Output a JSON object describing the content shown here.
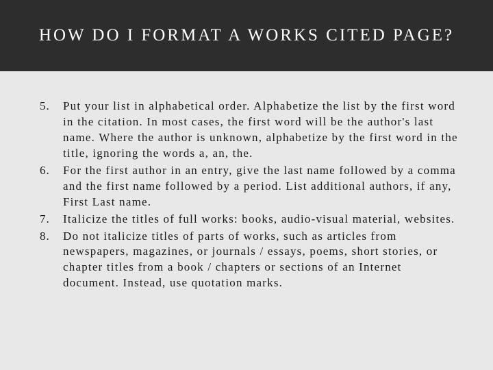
{
  "header": {
    "title": "HOW DO I FORMAT A WORKS CITED PAGE?"
  },
  "list": {
    "start": 5,
    "items": [
      "Put your list in alphabetical order. Alphabetize the list by the first word in the citation. In most cases, the first word will be the author's last name. Where the author is unknown, alphabetize by the first word in the title, ignoring the words a, an, the.",
      "For the first author in an entry, give the last name followed by a comma and the first name followed by a period. List additional authors, if any, First Last name.",
      "Italicize the titles of full works: books, audio-visual material, websites.",
      "Do not italicize titles of parts of works, such as articles from newspapers, magazines, or journals / essays, poems, short stories, or chapter titles from a book / chapters or sections of an Internet document. Instead, use quotation marks."
    ]
  }
}
